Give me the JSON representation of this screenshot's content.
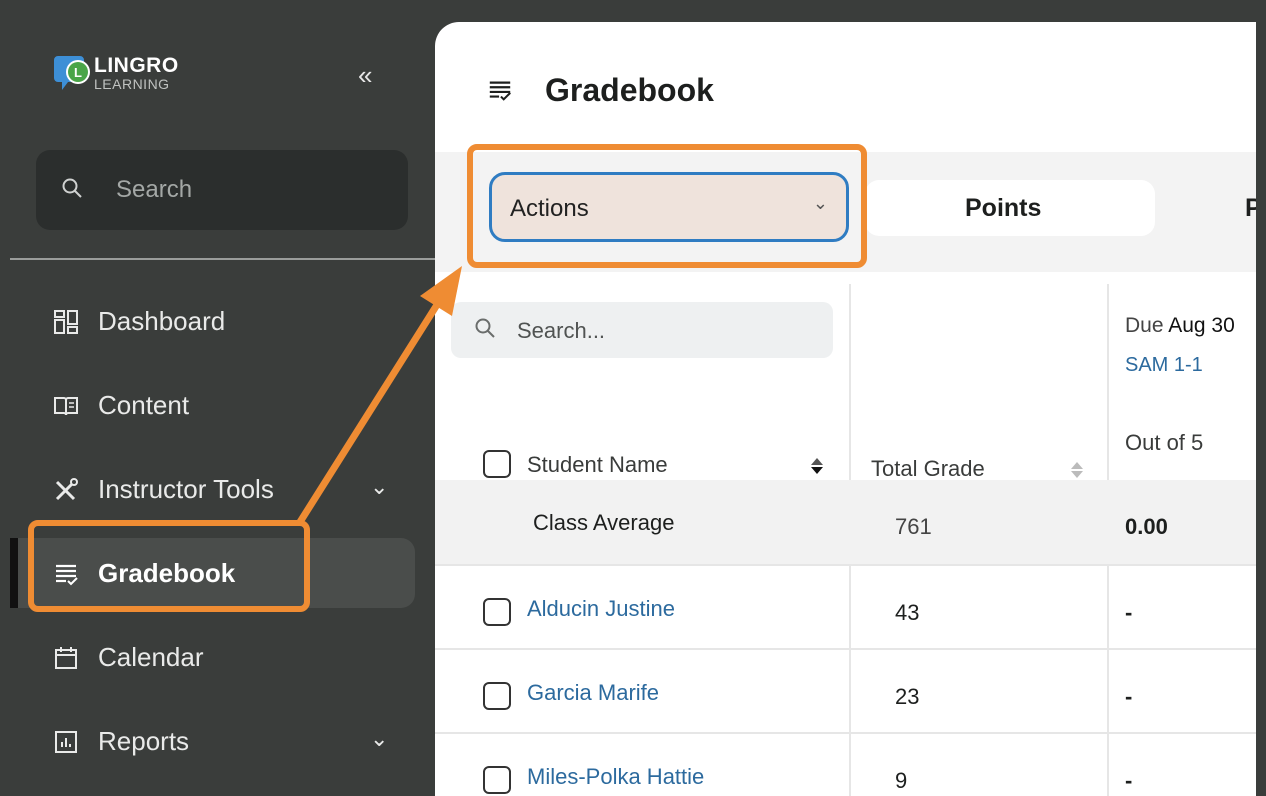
{
  "sidebar": {
    "logo": {
      "line1": "LINGRO",
      "line2": "LEARNING"
    },
    "collapse_glyph": "«",
    "search_placeholder": "Search",
    "items": [
      {
        "label": "Dashboard",
        "icon": "dashboard-icon"
      },
      {
        "label": "Content",
        "icon": "book-icon"
      },
      {
        "label": "Instructor Tools",
        "icon": "tools-icon",
        "has_chevron": true
      },
      {
        "label": "Gradebook",
        "icon": "gradebook-icon",
        "active": true
      },
      {
        "label": "Calendar",
        "icon": "calendar-icon"
      },
      {
        "label": "Reports",
        "icon": "reports-icon",
        "has_chevron": true
      }
    ]
  },
  "main": {
    "title": "Gradebook",
    "actions_label": "Actions",
    "tabs": [
      {
        "label": "Points",
        "selected": true
      },
      {
        "label": "P",
        "selected": false
      }
    ]
  },
  "table": {
    "search_placeholder": "Search...",
    "headers": {
      "student_name": "Student Name",
      "total_grade": "Total Grade",
      "due_prefix": "Due",
      "due_date": "Aug 30",
      "assignment": "SAM 1-1",
      "out_of": "Out of 5"
    },
    "class_average": {
      "label": "Class Average",
      "total": "761",
      "score": "0.00"
    },
    "rows": [
      {
        "name": "Alducin Justine",
        "total": "43",
        "score": "-"
      },
      {
        "name": "Garcia Marife",
        "total": "23",
        "score": "-"
      },
      {
        "name": "Miles-Polka Hattie",
        "total": "9",
        "score": "-"
      }
    ]
  },
  "colors": {
    "sidebar_bg": "#3a3d3b",
    "annotation_orange": "#ef8c33",
    "link_blue": "#2c6a9e",
    "select_border": "#2f7cc2"
  }
}
